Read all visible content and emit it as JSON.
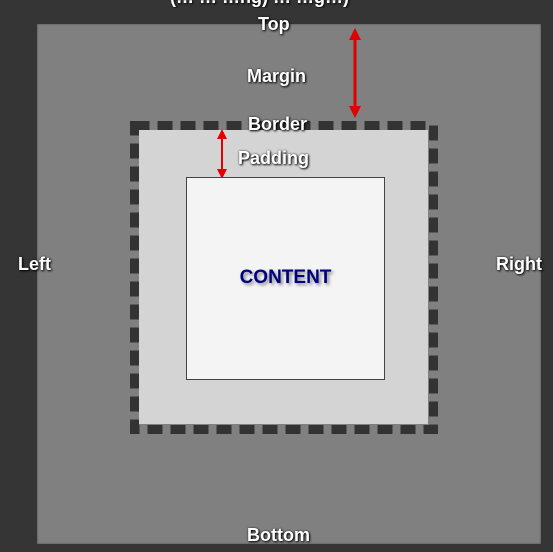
{
  "header": {
    "partial_caption": "(… … …ng) … …g…)"
  },
  "labels": {
    "top": "Top",
    "bottom": "Bottom",
    "left": "Left",
    "right": "Right",
    "margin": "Margin",
    "border": "Border",
    "padding": "Padding",
    "content": "CONTENT"
  },
  "colors": {
    "frame": "#353535",
    "margin_area": "#808080",
    "padding_area": "#d4d4d4",
    "content_area": "#f4f4f4",
    "border_dash": "#333333",
    "arrow": "#e00000",
    "content_text": "#000080",
    "label_text": "#ffffff"
  }
}
